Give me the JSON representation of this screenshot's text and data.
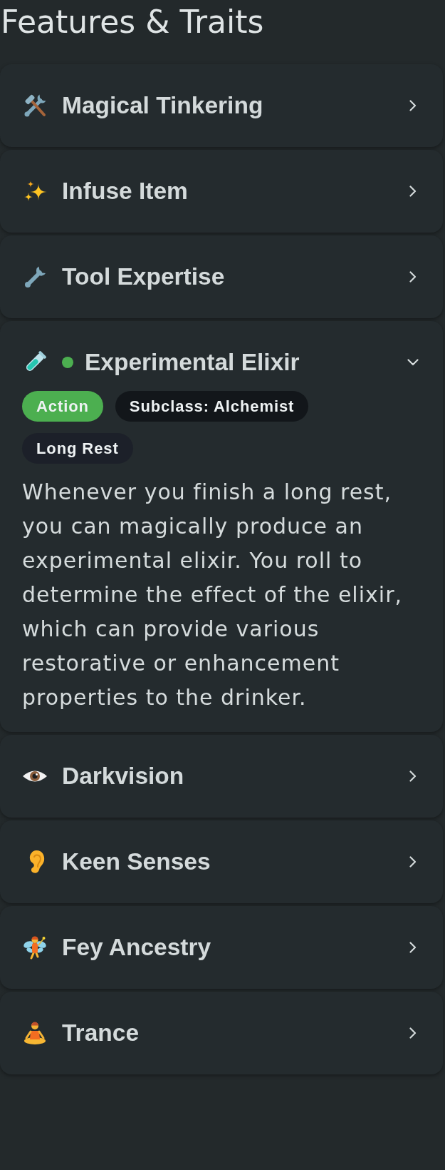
{
  "title": "Features & Traits",
  "features": [
    {
      "name": "Magical Tinkering",
      "expanded": false,
      "active": false
    },
    {
      "name": "Infuse Item",
      "expanded": false,
      "active": false
    },
    {
      "name": "Tool Expertise",
      "expanded": false,
      "active": false
    },
    {
      "name": "Experimental Elixir",
      "expanded": true,
      "active": true,
      "tags": [
        {
          "label": "Action",
          "color": "#4caf50"
        },
        {
          "label": "Subclass: Alchemist",
          "color": "#12161a"
        },
        {
          "label": "Long Rest",
          "color": "#1c2029"
        }
      ],
      "description": "Whenever you finish a long rest, you can magically produce an experimental elixir. You roll to determine the effect of the elixir, which can provide various restorative or enhancement properties to the drinker."
    },
    {
      "name": "Darkvision",
      "expanded": false,
      "active": false
    },
    {
      "name": "Keen Senses",
      "expanded": false,
      "active": false
    },
    {
      "name": "Fey Ancestry",
      "expanded": false,
      "active": false
    },
    {
      "name": "Trance",
      "expanded": false,
      "active": false
    }
  ]
}
